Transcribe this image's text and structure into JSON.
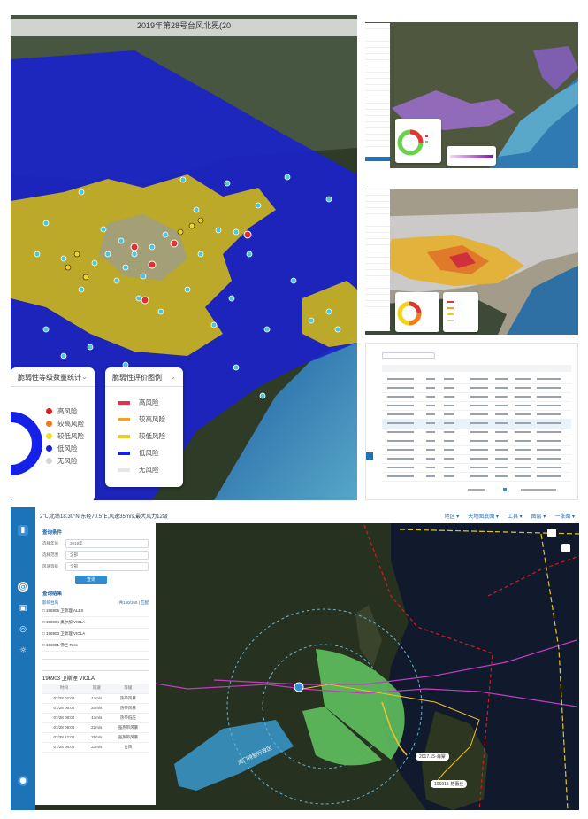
{
  "panel1": {
    "title": "2019年第28号台风北冕(20",
    "count_card": {
      "title": "脆弱性等级数量统计",
      "items": [
        {
          "label": "高风险",
          "color": "#e02020"
        },
        {
          "label": "较高风险",
          "color": "#f07d18"
        },
        {
          "label": "较低风险",
          "color": "#ede021"
        },
        {
          "label": "低风险",
          "color": "#1a23d8"
        },
        {
          "label": "无风险",
          "color": "#d5d5d5"
        }
      ]
    },
    "eval_card": {
      "title": "脆弱性评价图例",
      "items": [
        {
          "label": "高风险",
          "color": "#e8304a"
        },
        {
          "label": "较高风险",
          "color": "#f0a030"
        },
        {
          "label": "较低风险",
          "color": "#e8d020"
        },
        {
          "label": "低风险",
          "color": "#1520e0"
        },
        {
          "label": "无风险",
          "color": "#e6e6e6"
        }
      ]
    }
  },
  "panel5": {
    "topbar_text": "2℃,北纬18.30°N,东经70.5°E,风速35m/s,最大风力12级",
    "tools": [
      "地区",
      "天地图底图",
      "工具",
      "图层",
      "一张图"
    ],
    "typhoon_panel": {
      "filter_title": "查询条件",
      "filters": [
        {
          "label": "选择年份",
          "value": "2019年"
        },
        {
          "label": "选择范围",
          "value": "全部"
        },
        {
          "label": "风速等级",
          "value": "全部"
        }
      ],
      "query_button": "查询",
      "result_title": "查询结果",
      "result_head": "影响台风",
      "result_count": "共150/150 | 匹配",
      "typhoons": [
        "196905 卫斯理 ALEX",
        "196904 奥尔加 VIOLA",
        "196903 卫斯理 VIOLA",
        "196901 佛兰 Tess"
      ],
      "selected_title": "196903 卫斯理 VIOLA",
      "table_headers": [
        "时间",
        "风速",
        "等级"
      ],
      "table_rows": [
        [
          "07/28 02:00",
          "17m/s",
          "热带风暴"
        ],
        [
          "07/28 06:00",
          "20m/s",
          "热带风暴"
        ],
        [
          "07/28 08:00",
          "17m/s",
          "热带低压"
        ],
        [
          "07/28 09:00",
          "22m/s",
          "强热带风暴"
        ],
        [
          "07/28 12:00",
          "25m/s",
          "强热带风暴"
        ],
        [
          "07/28 08:00",
          "33m/s",
          "台风"
        ]
      ]
    },
    "map_labels": [
      "2017.15-海棠",
      "196915-格蕾丝"
    ],
    "area_label": "澳门特别行政区"
  }
}
